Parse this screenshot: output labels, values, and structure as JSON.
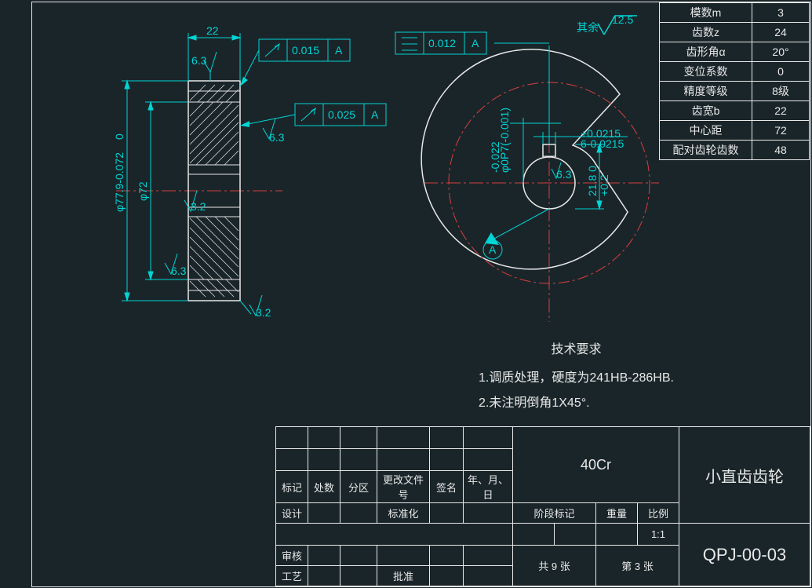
{
  "params": [
    {
      "label": "模数m",
      "value": "3"
    },
    {
      "label": "齿数z",
      "value": "24"
    },
    {
      "label": "齿形角α",
      "value": "20°"
    },
    {
      "label": "变位系数",
      "value": "0"
    },
    {
      "label": "精度等级",
      "value": "8级"
    },
    {
      "label": "齿宽b",
      "value": "22"
    },
    {
      "label": "中心距",
      "value": "72"
    },
    {
      "label": "配对齿轮齿数",
      "value": "48"
    }
  ],
  "dims": {
    "width": "22",
    "dia1": "φ77.9-0.072",
    "dia1_sup": "0",
    "dia2": "φ72",
    "sf6_3": "6.3",
    "sf3_2": "3.2",
    "gd1_val": "0.015",
    "gd1_datum": "A",
    "gd2_val": "0.025",
    "gd2_datum": "A",
    "gd3_val": "0.012",
    "gd3_datum": "A",
    "bore": "φ0P7(-0.001)",
    "bore_sup": "-0.022",
    "key_w": "6-0.0215",
    "key_w_sup": "+0.0215",
    "key_h": "21.8 0",
    "key_h_sup": "+0.2",
    "datum_a": "A",
    "rest_label": "其余",
    "rest_val": "12.5"
  },
  "tech": {
    "title": "技术要求",
    "line1": "1.调质处理，硬度为241HB-286HB.",
    "line2": "2.未注明倒角1X45°."
  },
  "tb": {
    "col_mark": "标记",
    "col_qty": "处数",
    "col_zone": "分区",
    "col_doc": "更改文件号",
    "col_sig": "签名",
    "col_date": "年、月、日",
    "row_des": "设计",
    "row_std": "标准化",
    "row_chk": "审核",
    "row_proc": "工艺",
    "row_appr": "批准",
    "stage": "阶段标记",
    "weight": "重量",
    "scale": "比例",
    "scale_val": "1:1",
    "sheets": "共 9 张",
    "sheet_no": "第 3 张",
    "material": "40Cr",
    "part_name": "小直齿齿轮",
    "dwg_no": "QPJ-00-03"
  }
}
